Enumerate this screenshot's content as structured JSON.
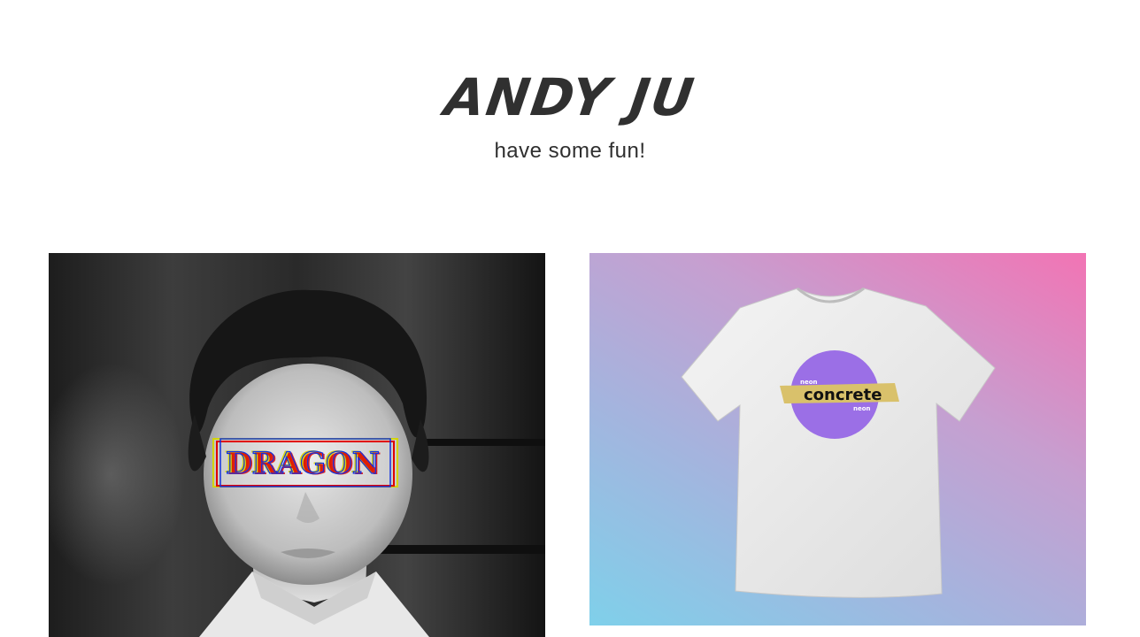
{
  "header": {
    "title": "ANDY JU",
    "tagline": "have some fun!"
  },
  "gallery": {
    "items": [
      {
        "overlay_text": "DRAGON",
        "icon": "portrait-image"
      },
      {
        "print_main": "concrete",
        "print_top": "neon",
        "print_bottom": "neon",
        "icon": "tshirt-image"
      }
    ]
  },
  "colors": {
    "title": "#303030",
    "tagline": "#2f2f2f",
    "gradient_start": "#7fd0ea",
    "gradient_end": "#f274b4",
    "print_circle": "#9b6fe6",
    "print_band": "#d9c16b"
  }
}
